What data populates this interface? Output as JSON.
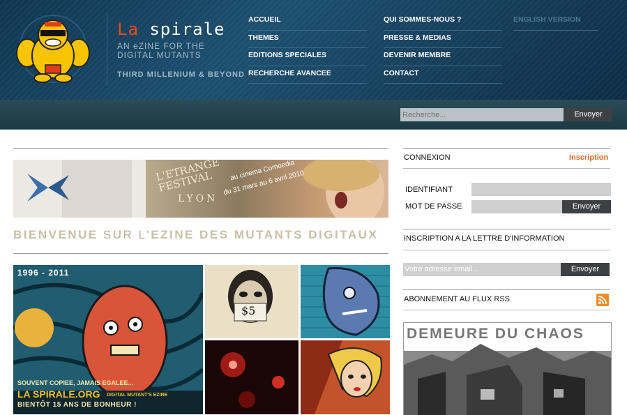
{
  "header": {
    "logo_la": "La",
    "logo_spirale": "spirale",
    "tagline_line1": "AN eZINE FOR THE",
    "tagline_line2": "DIGITAL MUTANTS",
    "tagline3": "THIRD MILLENIUM & BEYOND",
    "nav_col1": [
      "ACCUEIL",
      "THEMES",
      "EDITIONS SPECIALES",
      "RECHERCHE AVANCEE"
    ],
    "nav_col2": [
      "QUI SOMMES-NOUS ?",
      "PRESSE & MEDIAS",
      "DEVENIR MEMBRE",
      "CONTACT"
    ],
    "nav_col3": [
      "ENGLISH VERSION"
    ]
  },
  "search": {
    "placeholder": "Recherche...",
    "button": "Envoyer"
  },
  "main": {
    "banner": {
      "festival": "L'ETRANGE FESTIVAL",
      "city": "LYON",
      "venue": "au cinema Comoedia",
      "dates": "du 31 mars au 6 avril 2010"
    },
    "welcome_bienvenue": "BIENVENUE",
    "welcome_sur": "SUR L'",
    "welcome_rest": "EZINE DES MUTANTS DIGITAUX",
    "feature": {
      "years": "1996 - 2011",
      "line1": "SOUVENT COPIEE, JAMAIS EGALEE...",
      "site": "LA SPIRALE.ORG",
      "site_sub": "DIGITAL MUTANT'S EZINE",
      "line3": "BIENTÔT 15 ANS DE BONHEUR !"
    },
    "tile_price": "$5"
  },
  "sidebar": {
    "connexion": "CONNEXION",
    "inscription": "Inscription",
    "identifiant": "IDENTIFIANT",
    "mot_de_passe": "MOT DE PASSE",
    "login_button": "Envoyer",
    "newsletter_title": "INSCRIPTION A LA LETTRE D'INFORMATION",
    "newsletter_placeholder": "Votre adresse email...",
    "newsletter_button": "Envoyer",
    "rss": "ABONNEMENT AU FLUX RSS",
    "chaos_title": "DEMEURE DU CHAOS"
  },
  "colors": {
    "accent_orange": "#f26522",
    "header_blue": "#1d4f70",
    "welcome_beige": "#c9bfa8"
  },
  "icons": [
    "mascot-logo",
    "rss-icon"
  ]
}
